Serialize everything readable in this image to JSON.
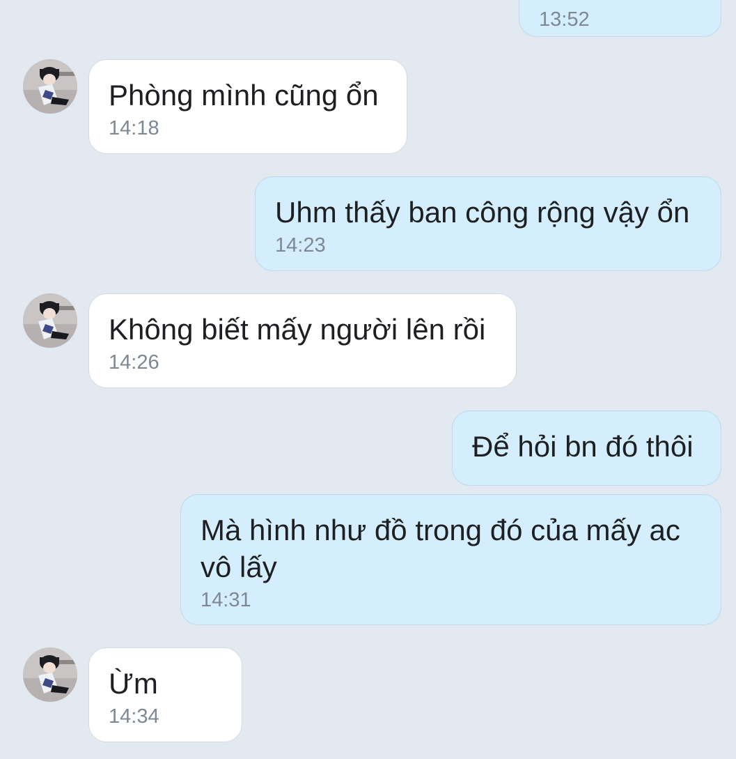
{
  "messages": [
    {
      "dir": "out",
      "text": "",
      "time": "13:52"
    },
    {
      "dir": "in",
      "text": "Phòng mình cũng ổn",
      "time": "14:18"
    },
    {
      "dir": "out",
      "text": "Uhm thấy ban công rộng vậy ổn",
      "time": "14:23"
    },
    {
      "dir": "in",
      "text": "Không biết mấy người lên rồi",
      "time": "14:26"
    },
    {
      "dir": "out",
      "text": "Để hỏi bn đó thôi",
      "time": ""
    },
    {
      "dir": "out",
      "text": "Mà hình như đồ trong đó của mấy ac vô lấy",
      "time": "14:31"
    },
    {
      "dir": "in",
      "text": "Ừm",
      "time": "14:34"
    }
  ],
  "contact": {
    "avatar_icon": "user-avatar-icon"
  },
  "colors": {
    "background": "#e2e9f1",
    "incoming_bubble": "#ffffff",
    "outgoing_bubble": "#d5eefd",
    "text": "#1d1f22",
    "time": "#7d8893"
  }
}
